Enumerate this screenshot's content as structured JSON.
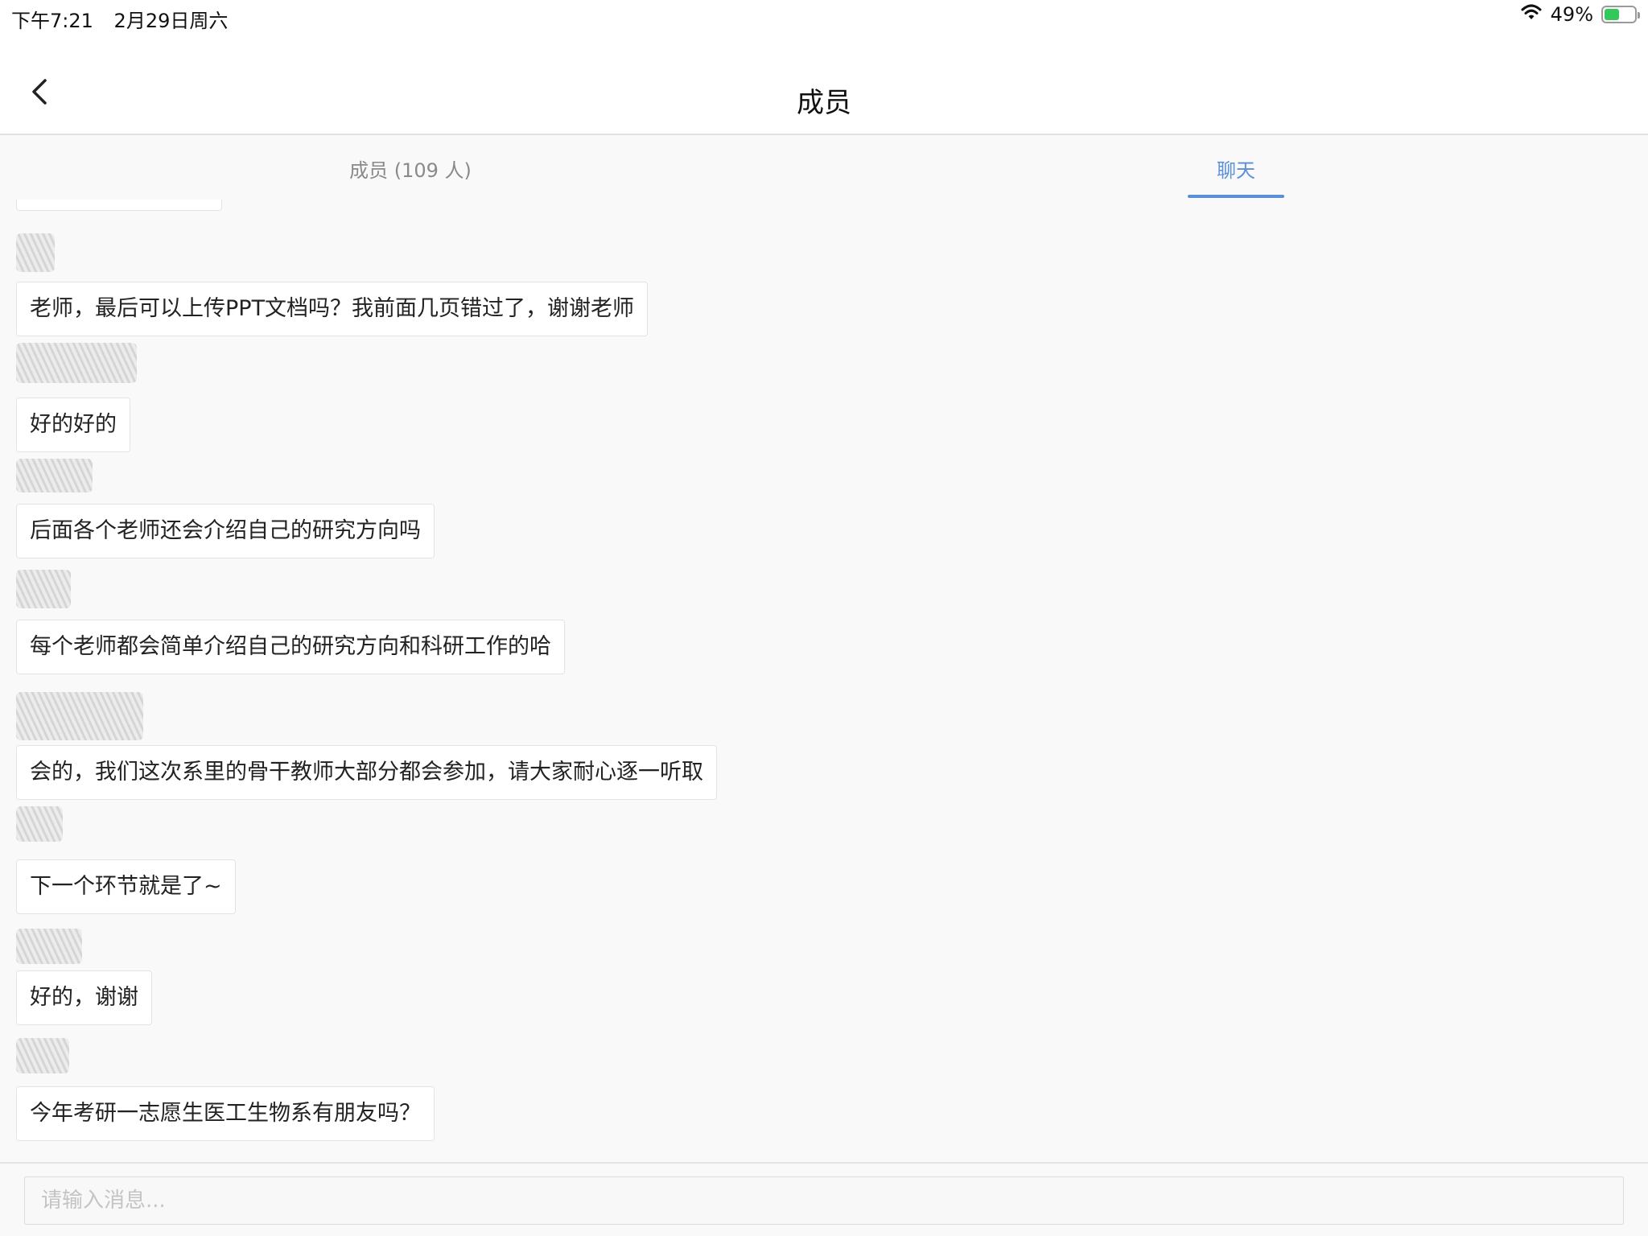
{
  "status_bar": {
    "time": "下午7:21",
    "date": "2月29日周六",
    "battery_text": "49%",
    "battery_level": 0.49,
    "battery_color": "#34c759",
    "wifi_icon": "wifi-icon"
  },
  "header": {
    "title": "成员",
    "back_icon": "chevron-left-icon"
  },
  "tabs": [
    {
      "label": "成员 (109 人)",
      "active": false
    },
    {
      "label": "聊天",
      "active": true
    }
  ],
  "accent_color": "#5b8fd9",
  "messages": [
    {
      "text": "老师，最后可以上传PPT文档吗？我前面几页错过了，谢谢老师"
    },
    {
      "text": "好的好的"
    },
    {
      "text": "后面各个老师还会介绍自己的研究方向吗"
    },
    {
      "text": "每个老师都会简单介绍自己的研究方向和科研工作的哈"
    },
    {
      "text": "会的，我们这次系里的骨干教师大部分都会参加，请大家耐心逐一听取"
    },
    {
      "text": "下一个环节就是了~"
    },
    {
      "text": "好的，谢谢"
    },
    {
      "text": "今年考研一志愿生医工生物系有朋友吗？"
    }
  ],
  "input": {
    "placeholder": "请输入消息..."
  }
}
